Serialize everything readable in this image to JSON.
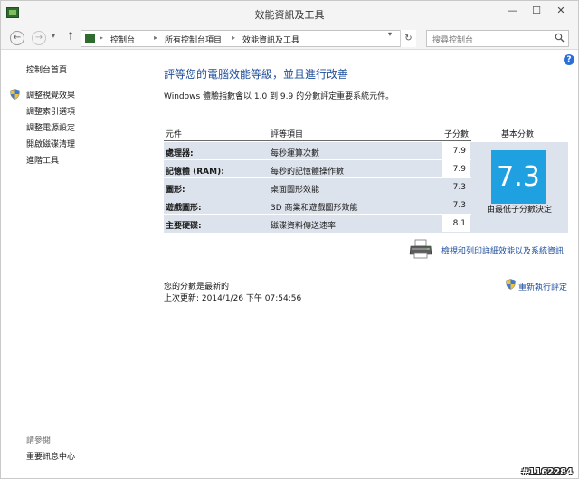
{
  "window": {
    "title": "效能資訊及工具"
  },
  "window_controls": {
    "minimize": "—",
    "maximize": "☐",
    "close": "✕"
  },
  "nav": {
    "back": "←",
    "forward": "→",
    "recent": "▾",
    "up": "↑",
    "breadcrumb": [
      "控制台",
      "所有控制台項目",
      "效能資訊及工具"
    ],
    "separator": "▸",
    "dropdown": "▾",
    "refresh": "↻",
    "search_placeholder": "搜尋控制台"
  },
  "help": "?",
  "sidebar": {
    "home": "控制台首頁",
    "links": [
      "調整視覺效果",
      "調整索引選項",
      "調整電源設定",
      "開啟磁碟清理",
      "進階工具"
    ],
    "see_also_label": "請參閱",
    "see_also_link": "重要訊息中心"
  },
  "main": {
    "heading": "評等您的電腦效能等級，並且進行改善",
    "description": "Windows 體驗指數會以 1.0 到 9.9 的分數評定重要系統元件。",
    "columns": {
      "component": "元件",
      "item": "評等項目",
      "subscore": "子分數",
      "base": "基本分數"
    },
    "rows": [
      {
        "component": "處理器:",
        "item": "每秒運算次數",
        "score": "7.9"
      },
      {
        "component": "記憶體 (RAM):",
        "item": "每秒的記憶體操作數",
        "score": "7.9"
      },
      {
        "component": "圖形:",
        "item": "桌面圖形效能",
        "score": "7.3"
      },
      {
        "component": "遊戲圖形:",
        "item": "3D 商業和遊戲圖形效能",
        "score": "7.3"
      },
      {
        "component": "主要硬碟:",
        "item": "磁碟資料傳送速率",
        "score": "8.1"
      }
    ],
    "base_score": "7.3",
    "base_note": "由最低子分數決定",
    "print_link": "檢視和列印詳細效能以及系統資訊",
    "status_line1": "您的分數是最新的",
    "status_line2": "上次更新: 2014/1/26 下午 07:54:56",
    "rerun_link": "重新執行評定"
  },
  "watermark": "#1162284",
  "colors": {
    "accent": "#1f4e9c",
    "base_tile": "#1fa0e0",
    "table_bg": "#dde3ec"
  }
}
